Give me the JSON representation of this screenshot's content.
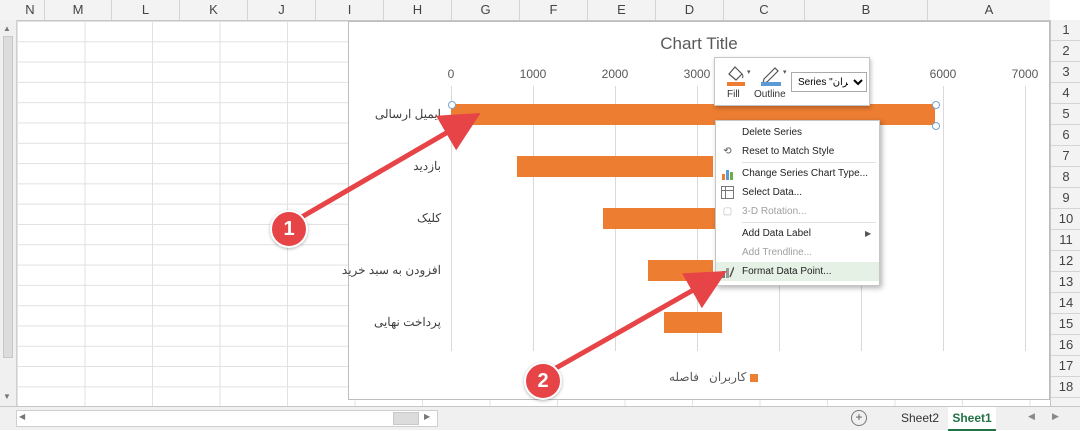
{
  "sheet": {
    "columns": [
      "N",
      "M",
      "L",
      "K",
      "J",
      "I",
      "H",
      "G",
      "F",
      "E",
      "D",
      "C",
      "B",
      "A"
    ],
    "rows": [
      "1",
      "2",
      "3",
      "4",
      "5",
      "6",
      "7",
      "8",
      "9",
      "10",
      "11",
      "12",
      "13",
      "14",
      "15",
      "16",
      "17",
      "18"
    ]
  },
  "chart_data": {
    "type": "bar",
    "title": "Chart Title",
    "orientation": "horizontal",
    "direction": "rtl",
    "xlim": [
      0,
      7000
    ],
    "ticks": [
      "0",
      "1000",
      "2000",
      "3000",
      "4000",
      "5000",
      "6000",
      "7000"
    ],
    "visible_ticks": [
      "0",
      "1000",
      "2000",
      "3000",
      "6000",
      "7000"
    ],
    "categories": [
      "ایمیل ارسالی",
      "بازدید",
      "کلیک",
      "افزودن به سبد خرید",
      "پرداخت نهایی"
    ],
    "series": [
      {
        "name": "فاصله",
        "values": [
          0,
          800,
          1850,
          2400,
          2600
        ],
        "hidden": true
      },
      {
        "name": "کاربران",
        "values": [
          5900,
          2400,
          1400,
          800,
          700
        ],
        "color": "#ed7d31"
      }
    ],
    "legend_placement": "bottom",
    "grid": true
  },
  "mini_toolbar": {
    "fill_label": "Fill",
    "outline_label": "Outline",
    "series_selector_value": "Series \"کاربران\""
  },
  "context_menu": {
    "items": [
      {
        "label": "Delete Series",
        "icon": "",
        "disabled": false
      },
      {
        "label": "Reset to Match Style",
        "icon": "reset-style-icon",
        "disabled": false
      },
      {
        "label": "Change Series Chart Type...",
        "icon": "chart-type-icon",
        "disabled": false
      },
      {
        "label": "Select Data...",
        "icon": "select-data-icon",
        "disabled": false
      },
      {
        "label": "3-D Rotation...",
        "icon": "rotation-icon",
        "disabled": true
      },
      {
        "label": "Add Data Label",
        "icon": "",
        "disabled": false,
        "submenu": true
      },
      {
        "label": "Add Trendline...",
        "icon": "",
        "disabled": true
      },
      {
        "label": "Format Data Point...",
        "icon": "format-icon",
        "disabled": false,
        "highlighted": true
      }
    ]
  },
  "annotations": [
    "1",
    "2"
  ],
  "sheet_tabs": [
    "Sheet2",
    "Sheet1"
  ],
  "active_tab": "Sheet1",
  "colors": {
    "bar": "#ed7d31",
    "annotation": "#e64447",
    "active_tab": "#217346"
  }
}
